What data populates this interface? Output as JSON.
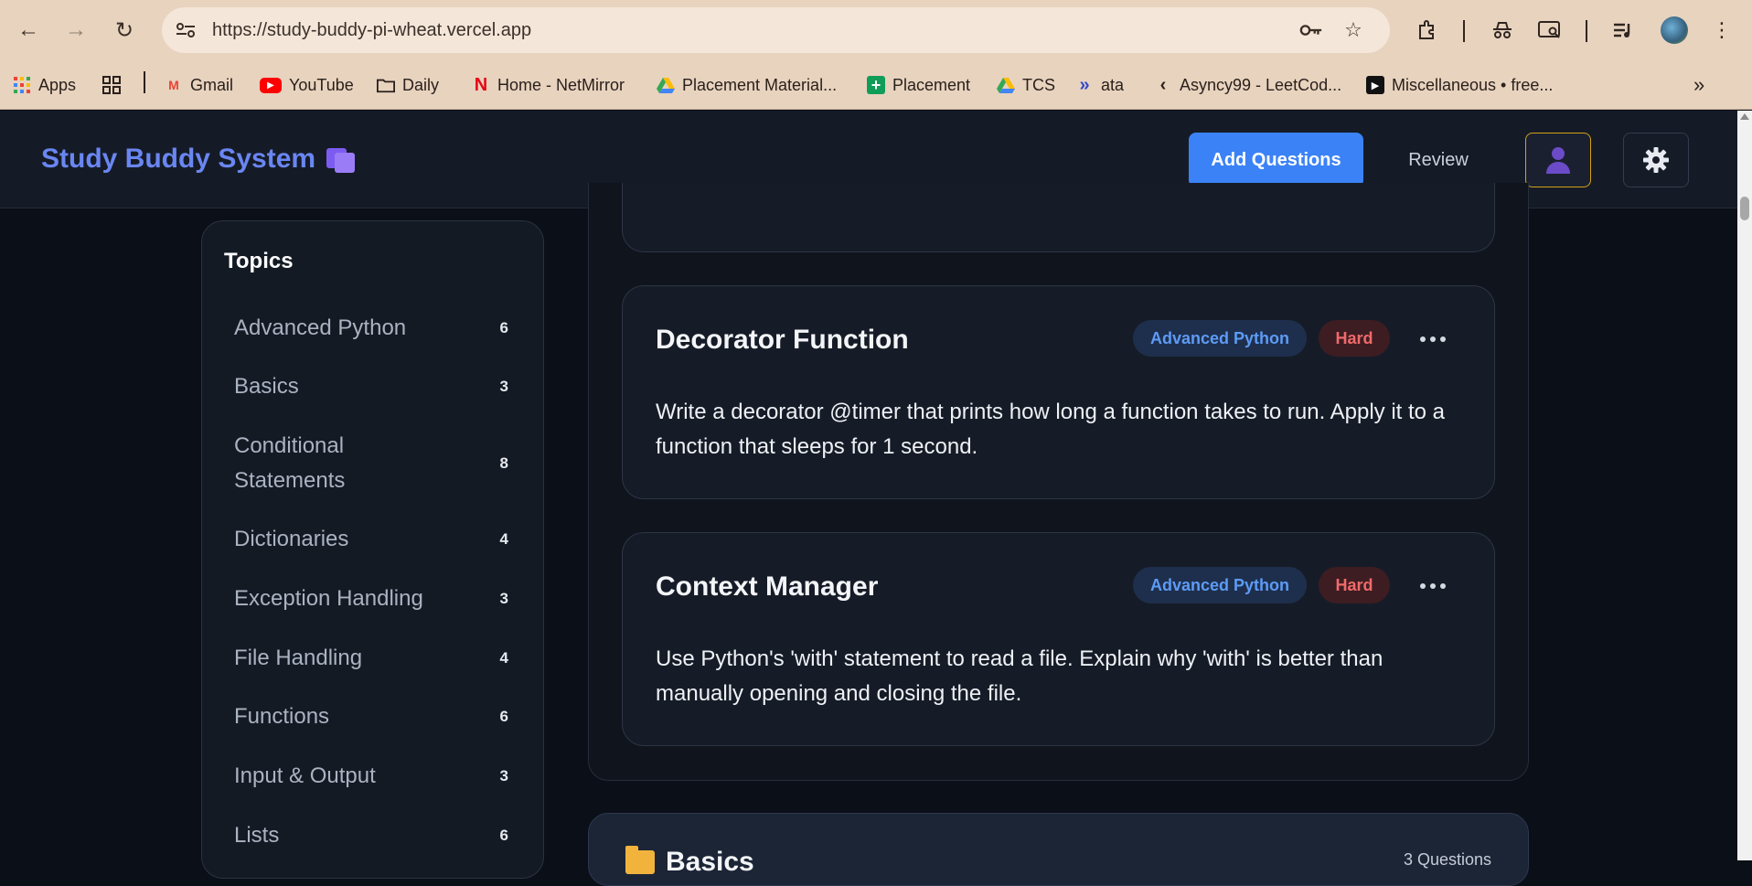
{
  "browser": {
    "url": "https://study-buddy-pi-wheat.vercel.app",
    "bookmarks": [
      {
        "label": "Apps",
        "icon": "apps-grid-icon"
      },
      {
        "label": "",
        "icon": "tab-groups-icon"
      },
      {
        "label": "Gmail",
        "icon": "gmail-icon"
      },
      {
        "label": "YouTube",
        "icon": "youtube-icon"
      },
      {
        "label": "Daily",
        "icon": "folder-icon"
      },
      {
        "label": "Home - NetMirror",
        "icon": "netmirror-icon"
      },
      {
        "label": "Placement Material...",
        "icon": "google-drive-icon"
      },
      {
        "label": "Placement",
        "icon": "google-sheets-icon"
      },
      {
        "label": "TCS",
        "icon": "google-drive-icon"
      },
      {
        "label": "ata",
        "icon": "ata-icon"
      },
      {
        "label": "Asyncy99 - LeetCod...",
        "icon": "leetcode-icon"
      },
      {
        "label": "Miscellaneous • free...",
        "icon": "play-icon"
      }
    ],
    "overflow": "»"
  },
  "header": {
    "brand": "Study Buddy System",
    "add_questions": "Add Questions",
    "review": "Review"
  },
  "sidebar": {
    "title": "Topics",
    "topics": [
      {
        "label": "Advanced Python",
        "count": "6"
      },
      {
        "label": "Basics",
        "count": "3"
      },
      {
        "label": "Conditional Statements",
        "count": "8"
      },
      {
        "label": "Dictionaries",
        "count": "4"
      },
      {
        "label": "Exception Handling",
        "count": "3"
      },
      {
        "label": "File Handling",
        "count": "4"
      },
      {
        "label": "Functions",
        "count": "6"
      },
      {
        "label": "Input & Output",
        "count": "3"
      },
      {
        "label": "Lists",
        "count": "6"
      }
    ]
  },
  "questions": [
    {
      "title": "Decorator Function",
      "topic": "Advanced Python",
      "difficulty": "Hard",
      "body": "Write a decorator @timer that prints how long a function takes to run. Apply it to a function that sleeps for 1 second."
    },
    {
      "title": "Context Manager",
      "topic": "Advanced Python",
      "difficulty": "Hard",
      "body": "Use Python's 'with' statement to read a file. Explain why 'with' is better than manually opening and closing the file."
    }
  ],
  "next_section": {
    "title": "Basics",
    "count": "3 Questions"
  },
  "colors": {
    "accent": "#3b82f6",
    "brand": "#6a86f2",
    "hard": "#f06a6a",
    "topic_badge": "#5d9bf5"
  }
}
